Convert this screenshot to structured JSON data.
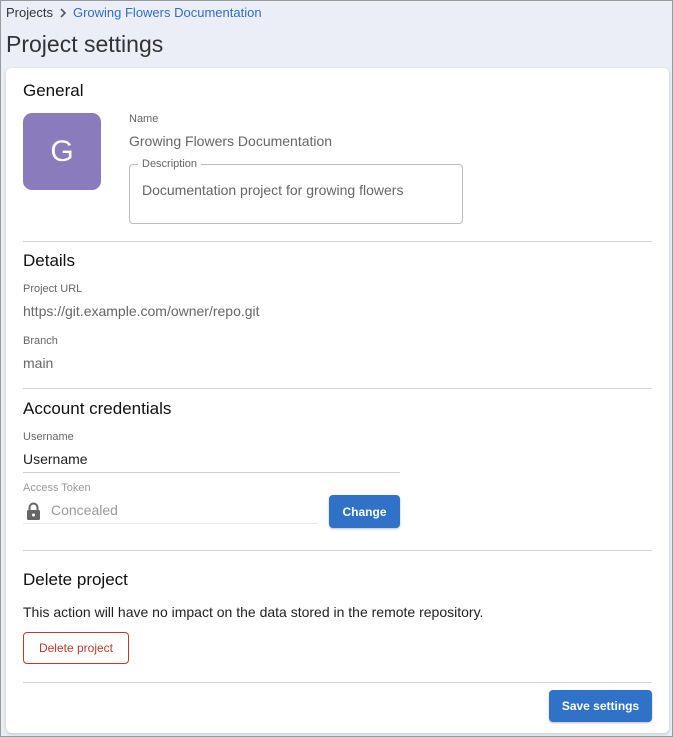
{
  "breadcrumb": {
    "root": "Projects",
    "current": "Growing Flowers Documentation"
  },
  "page_title": "Project settings",
  "general": {
    "title": "General",
    "avatar_letter": "G",
    "avatar_color": "#8a7bbd",
    "name_label": "Name",
    "name_value": "Growing Flowers Documentation",
    "description_label": "Description",
    "description_value": "Documentation project for growing flowers"
  },
  "details": {
    "title": "Details",
    "url_label": "Project URL",
    "url_value": "https://git.example.com/owner/repo.git",
    "branch_label": "Branch",
    "branch_value": "main"
  },
  "credentials": {
    "title": "Account credentials",
    "username_label": "Username",
    "username_value": "Username",
    "token_label": "Access Token",
    "token_value": "Concealed",
    "token_icon": "lock-icon",
    "change_label": "Change"
  },
  "delete": {
    "title": "Delete project",
    "description": "This action will have no impact on the data stored in the remote repository.",
    "button_label": "Delete project",
    "button_color": "#c0392b"
  },
  "footer": {
    "save_label": "Save settings"
  },
  "colors": {
    "primary": "#2f72c8",
    "link": "#2f6fbf",
    "background": "#eceef7"
  }
}
